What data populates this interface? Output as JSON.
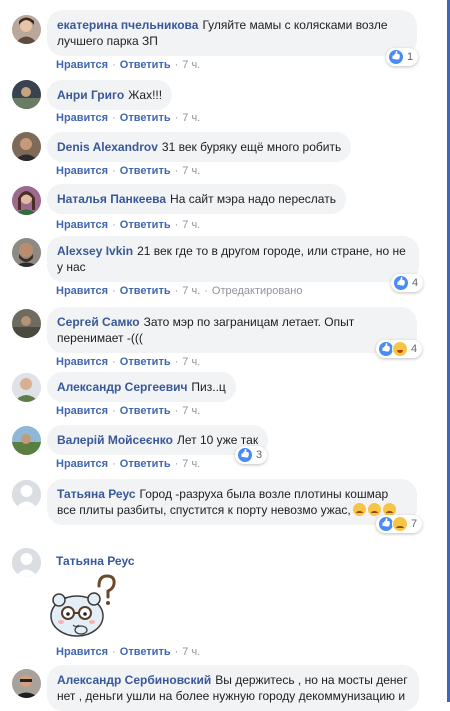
{
  "actions": {
    "like": "Нравится",
    "reply": "Ответить",
    "sep": "·"
  },
  "comments": [
    {
      "author": "екатерина пчельникова",
      "text": "Гуляйте мамы с колясками возле лучшего парка ЗП",
      "time": "7 ч.",
      "reactions": "1"
    },
    {
      "author": "Анри Григо",
      "text": "Жах!!!",
      "time": "7 ч."
    },
    {
      "author": "Denis Alexandrov",
      "text": "31 век буряку ещё много робить",
      "time": "7 ч."
    },
    {
      "author": "Наталья Панкеева",
      "text": "На сайт мэра надо переслать",
      "time": "7 ч."
    },
    {
      "author": "Alexsey Ivkin",
      "text": "21 век где то в другом городе, или стране, но не у нас",
      "time": "7 ч.",
      "edited": "Отредактировано",
      "reactions": "4"
    },
    {
      "author": "Сергей Самко",
      "text": "Зато мэр по заграницам летает. Опыт перенимает -(((",
      "time": "7 ч.",
      "reactions": "4"
    },
    {
      "author": "Александр Сергеевич",
      "text": "Пиз..ц",
      "time": "7 ч."
    },
    {
      "author": "Валерій Мойсеєнко",
      "text": "Лет 10 уже так",
      "time": "7 ч.",
      "reactions": "3"
    },
    {
      "author": "Татьяна Реус",
      "text": "Город -разруха была возле плотины кошмар все плиты разбиты, спустится к порту невозмо ужас,",
      "time": "7 ч.",
      "reactions": "7"
    },
    {
      "author": "Татьяна Реус",
      "text": "",
      "time": "7 ч."
    },
    {
      "author": "Александр Сербиновский",
      "text": "Вы держитесь , но на мосты денег нет , деньги ушли на более нужную городу декоммунизацию и"
    }
  ]
}
